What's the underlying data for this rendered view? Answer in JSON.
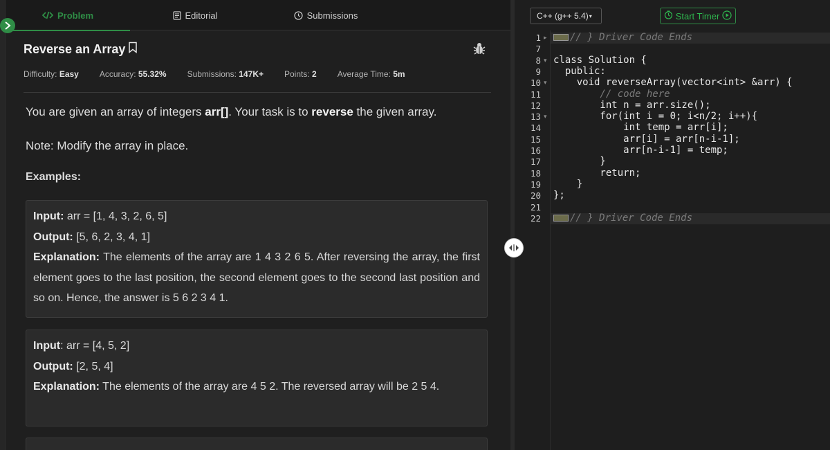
{
  "tabs": [
    {
      "label": "Problem",
      "icon": "code-icon",
      "active": true
    },
    {
      "label": "Editorial",
      "icon": "document-icon",
      "active": false
    },
    {
      "label": "Submissions",
      "icon": "clock-icon",
      "active": false
    }
  ],
  "problem": {
    "title": "Reverse an Array",
    "meta": {
      "difficulty_label": "Difficulty:",
      "difficulty": "Easy",
      "accuracy_label": "Accuracy:",
      "accuracy": "55.32%",
      "submissions_label": "Submissions:",
      "submissions": "147K+",
      "points_label": "Points:",
      "points": "2",
      "avg_time_label": "Average Time:",
      "avg_time": "5m"
    },
    "desc_1": "You are given an array of integers ",
    "desc_bold_1": "arr[]",
    "desc_2": ". Your task is to ",
    "desc_bold_2": "reverse",
    "desc_3": " the given array.",
    "note": "Note: Modify the array in place.",
    "examples_heading": "Examples:",
    "examples": [
      {
        "input_label": "Input:",
        "input": "arr = [1, 4, 3, 2, 6, 5]",
        "output_label": "Output:",
        "output": "[5, 6, 2, 3, 4, 1]",
        "explanation_label": "Explanation:",
        "explanation": "The elements of the array are 1 4 3 2 6 5. After reversing the array, the first element goes to the last position, the second element goes to the second last position and so on. Hence, the answer is 5 6 2 3 4 1."
      },
      {
        "input_label": "Input",
        "input": ": arr = [4, 5, 2]",
        "output_label": "Output:",
        "output": "[2, 5, 4]",
        "explanation_label": "Explanation:",
        "explanation": "The elements of the array are 4 5 2. The reversed array will be 2 5 4."
      }
    ]
  },
  "editor": {
    "language": "C++ (g++ 5.4)",
    "start_timer_label": "Start Timer",
    "lines": [
      {
        "n": "1",
        "text": "// } Driver Code Ends",
        "comment": true,
        "marker": true
      },
      {
        "n": "7",
        "text": ""
      },
      {
        "n": "8",
        "text": "class Solution {"
      },
      {
        "n": "9",
        "text": "  public:"
      },
      {
        "n": "10",
        "text": "    void reverseArray(vector<int> &arr) {"
      },
      {
        "n": "11",
        "text": "        // code here",
        "comment": true
      },
      {
        "n": "12",
        "text": "        int n = arr.size();"
      },
      {
        "n": "13",
        "text": "        for(int i = 0; i<n/2; i++){"
      },
      {
        "n": "14",
        "text": "            int temp = arr[i];"
      },
      {
        "n": "15",
        "text": "            arr[i] = arr[n-i-1];"
      },
      {
        "n": "16",
        "text": "            arr[n-i-1] = temp;"
      },
      {
        "n": "17",
        "text": "        }"
      },
      {
        "n": "18",
        "text": "        return;"
      },
      {
        "n": "19",
        "text": "    }"
      },
      {
        "n": "20",
        "text": "};"
      },
      {
        "n": "21",
        "text": ""
      },
      {
        "n": "22",
        "text": "// } Driver Code Ends",
        "comment": true,
        "marker": true
      }
    ]
  }
}
